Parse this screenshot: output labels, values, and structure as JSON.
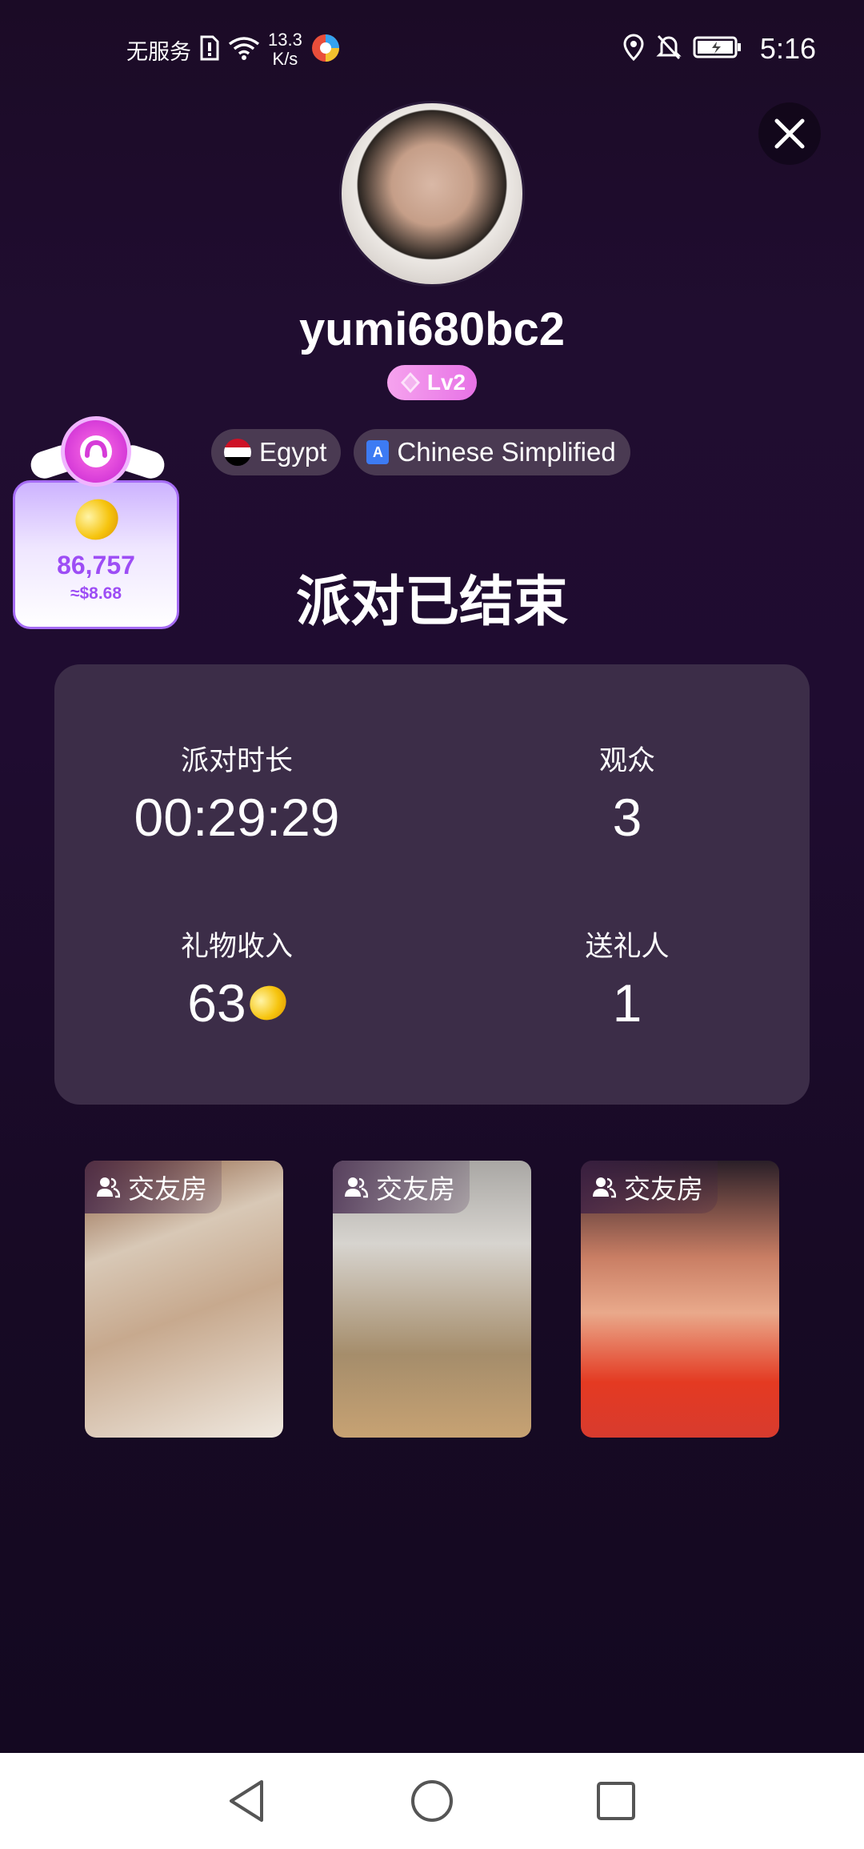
{
  "status_bar": {
    "carrier": "无服务",
    "net_speed_value": "13.3",
    "net_speed_unit": "K/s",
    "time": "5:16"
  },
  "profile": {
    "username": "yumi680bc2",
    "level": "Lv2",
    "country": "Egypt",
    "language": "Chinese Simplified"
  },
  "coin_widget": {
    "value": "86,757",
    "usd": "≈$8.68"
  },
  "title": "派对已结束",
  "stats": {
    "duration_label": "派对时长",
    "duration_value": "00:29:29",
    "audience_label": "观众",
    "audience_value": "3",
    "gift_income_label": "礼物收入",
    "gift_income_value": "63",
    "gifters_label": "送礼人",
    "gifters_value": "1"
  },
  "rooms": [
    {
      "label": "交友房"
    },
    {
      "label": "交友房"
    },
    {
      "label": "交友房"
    }
  ],
  "colors": {
    "accent_purple": "#9d4df5",
    "level_pink": "#e772e6",
    "card_bg": "#3c2d48"
  }
}
